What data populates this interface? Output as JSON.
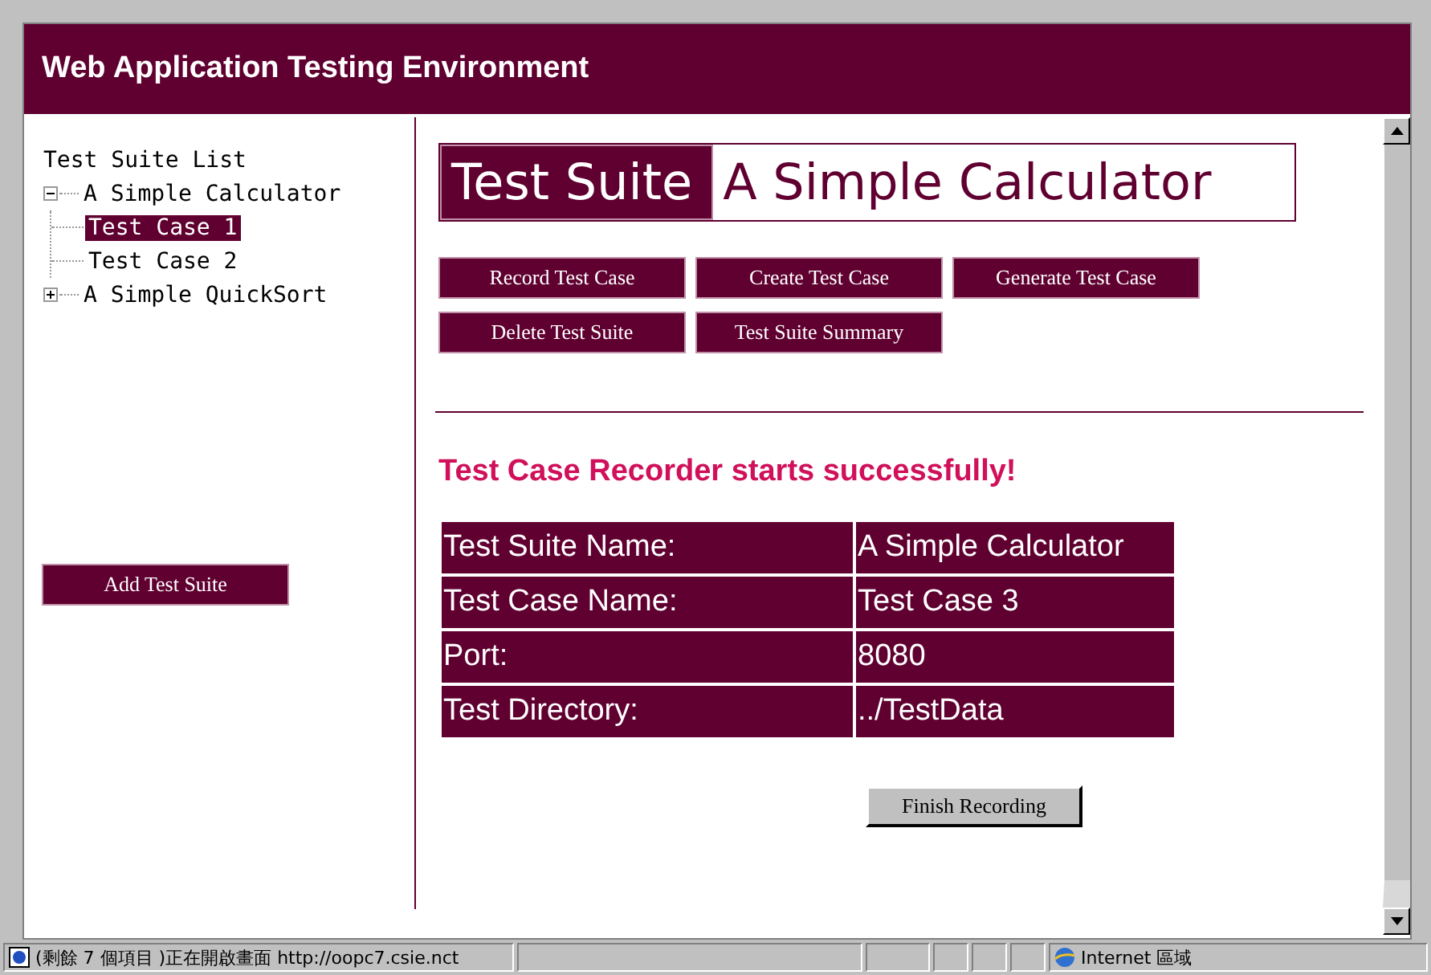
{
  "header": {
    "title": "Web Application Testing Environment"
  },
  "tree": {
    "title": "Test Suite List",
    "items": [
      {
        "label": "A Simple Calculator",
        "expanded": true,
        "selected": false,
        "children": [
          {
            "label": "Test Case 1",
            "selected": true
          },
          {
            "label": "Test Case 2",
            "selected": false
          }
        ]
      },
      {
        "label": "A Simple QuickSort",
        "expanded": false,
        "selected": false
      }
    ]
  },
  "add_button": "Add Test Suite",
  "suite_heading": {
    "label": "Test Suite",
    "name": "A Simple Calculator"
  },
  "actions": [
    [
      "Record Test Case",
      "Create Test Case",
      "Generate Test Case"
    ],
    [
      "Delete Test Suite",
      "Test Suite Summary"
    ]
  ],
  "message": "Test Case Recorder starts successfully!",
  "info_rows": [
    {
      "label": "Test Suite Name:",
      "value": "A Simple Calculator"
    },
    {
      "label": "Test Case Name:",
      "value": "Test Case 3"
    },
    {
      "label": "Port:",
      "value": "8080"
    },
    {
      "label": "Test Directory:",
      "value": "../TestData"
    }
  ],
  "finish_button": "Finish Recording",
  "status_bar": {
    "text": "(剩餘 7 個項目 )正在開啟畫面 http://oopc7.csie.nct",
    "zone": "Internet 區域"
  }
}
